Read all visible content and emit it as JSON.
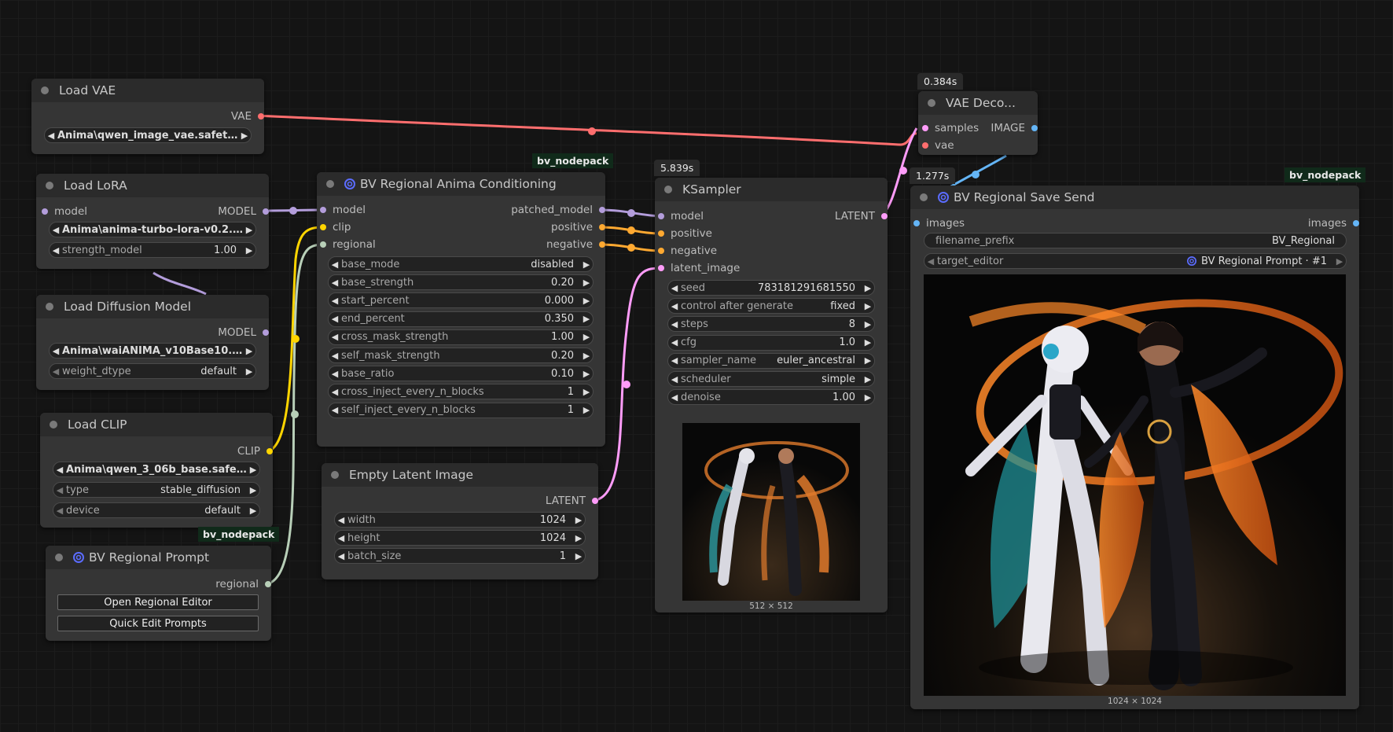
{
  "colors": {
    "vae": "#ff6e6e",
    "model": "#b39ddb",
    "clip": "#ffd500",
    "regional": "#b8cfb8",
    "conditioning": "#ffa931",
    "latent": "#ff9cf9",
    "image": "#64b5f6"
  },
  "load_vae": {
    "title": "Load VAE",
    "out_vae": "VAE",
    "vae_name": "Anima\\qwen_image_vae.safete ..."
  },
  "load_lora": {
    "title": "Load LoRA",
    "in_model": "model",
    "out_model": "MODEL",
    "lora_name": "Anima\\anima-turbo-lora-v0.2.s...",
    "strength_label": "strength_model",
    "strength_value": "1.00"
  },
  "load_diffusion": {
    "title": "Load Diffusion Model",
    "out_model": "MODEL",
    "unet_name": "Anima\\waiANIMA_v10Base10.s ...",
    "dtype_label": "weight_dtype",
    "dtype_value": "default"
  },
  "load_clip": {
    "title": "Load CLIP",
    "out_clip": "CLIP",
    "clip_name": "Anima\\qwen_3_06b_base.safet ...",
    "type_label": "type",
    "type_value": "stable_diffusion",
    "device_label": "device",
    "device_value": "default"
  },
  "bv_prompt": {
    "tag": "bv_nodepack",
    "title": "BV Regional Prompt",
    "out_regional": "regional",
    "open_button": "Open Regional Editor",
    "quick_button": "Quick Edit Prompts"
  },
  "bv_anima": {
    "tag": "bv_nodepack",
    "title": "BV Regional Anima Conditioning",
    "inputs": [
      "model",
      "clip",
      "regional"
    ],
    "outputs": [
      "patched_model",
      "positive",
      "negative"
    ],
    "widgets": [
      {
        "label": "base_mode",
        "value": "disabled"
      },
      {
        "label": "base_strength",
        "value": "0.20"
      },
      {
        "label": "start_percent",
        "value": "0.000"
      },
      {
        "label": "end_percent",
        "value": "0.350"
      },
      {
        "label": "cross_mask_strength",
        "value": "1.00"
      },
      {
        "label": "self_mask_strength",
        "value": "0.20"
      },
      {
        "label": "base_ratio",
        "value": "0.10"
      },
      {
        "label": "cross_inject_every_n_blocks",
        "value": "1"
      },
      {
        "label": "self_inject_every_n_blocks",
        "value": "1"
      }
    ]
  },
  "empty_latent": {
    "title": "Empty Latent Image",
    "out_latent": "LATENT",
    "widgets": [
      {
        "label": "width",
        "value": "1024"
      },
      {
        "label": "height",
        "value": "1024"
      },
      {
        "label": "batch_size",
        "value": "1"
      }
    ]
  },
  "ksampler": {
    "time": "5.839s",
    "title": "KSampler",
    "inputs": [
      "model",
      "positive",
      "negative",
      "latent_image"
    ],
    "out_latent": "LATENT",
    "widgets": [
      {
        "label": "seed",
        "value": "783181291681550"
      },
      {
        "label": "control after generate",
        "value": "fixed"
      },
      {
        "label": "steps",
        "value": "8"
      },
      {
        "label": "cfg",
        "value": "1.0"
      },
      {
        "label": "sampler_name",
        "value": "euler_ancestral"
      },
      {
        "label": "scheduler",
        "value": "simple"
      },
      {
        "label": "denoise",
        "value": "1.00"
      }
    ],
    "preview_caption": "512 × 512"
  },
  "vae_decode": {
    "time": "0.384s",
    "title": "VAE Deco...",
    "in_samples": "samples",
    "in_vae": "vae",
    "out_image": "IMAGE"
  },
  "bv_save": {
    "time": "1.277s",
    "tag": "bv_nodepack",
    "title": "BV Regional Save Send",
    "in_images": "images",
    "out_images": "images",
    "prefix_label": "filename_prefix",
    "prefix_value": "BV_Regional",
    "target_label": "target_editor",
    "target_value": "BV Regional Prompt · #1",
    "preview_caption": "1024 × 1024"
  }
}
